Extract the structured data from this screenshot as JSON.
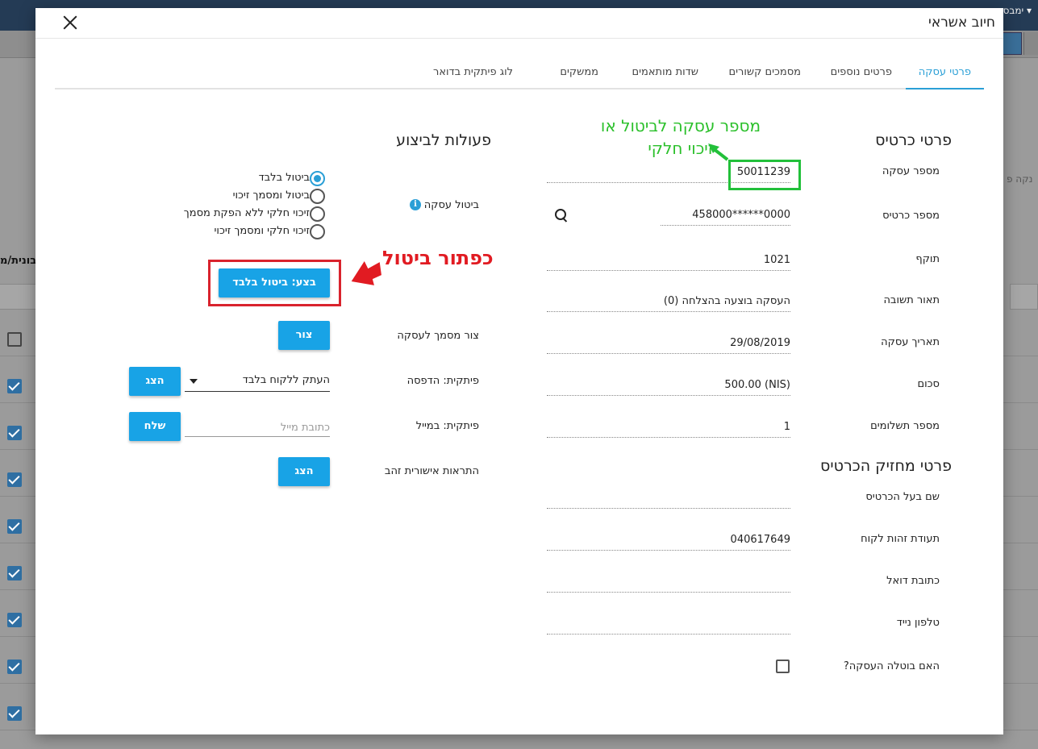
{
  "background": {
    "topbar_text": "ימבס ▾",
    "left_column_header": "בונית/מ",
    "right_filter_text": "נקה פ"
  },
  "modal": {
    "title": "חיוב אשראי",
    "tabs": [
      {
        "label": "פרטי עסקה",
        "active": true
      },
      {
        "label": "פרטים נוספים",
        "active": false
      },
      {
        "label": "מסמכים קשורים",
        "active": false
      },
      {
        "label": "שדות מותאמים",
        "active": false
      },
      {
        "label": "ממשקים",
        "active": false
      },
      {
        "label": "לוג פיתקית בדואר",
        "active": false
      }
    ],
    "card_section": {
      "title": "פרטי כרטיס",
      "fields": [
        {
          "label": "מספר עסקה",
          "value": "50011239"
        },
        {
          "label": "מספר כרטיס",
          "value": "458000******0000"
        },
        {
          "label": "תוקף",
          "value": "1021"
        },
        {
          "label": "תאור תשובה",
          "value": "העסקה בוצעה בהצלחה (0)"
        },
        {
          "label": "תאריך עסקה",
          "value": "29/08/2019"
        },
        {
          "label": "סכום",
          "value": "500.00 (NIS)"
        },
        {
          "label": "מספר תשלומים",
          "value": "1"
        }
      ]
    },
    "holder_section": {
      "title": "פרטי מחזיק הכרטיס",
      "fields": [
        {
          "label": "שם בעל הכרטיס",
          "value": ""
        },
        {
          "label": "תעודת זהות לקוח",
          "value": "040617649"
        },
        {
          "label": "כתובת דואל",
          "value": ""
        },
        {
          "label": "טלפון נייד",
          "value": ""
        }
      ],
      "cancelled_label": "האם בוטלה העסקה?"
    },
    "actions_section": {
      "title": "פעולות לביצוע",
      "cancel_label": "ביטול עסקה",
      "radio_options": [
        {
          "label": "ביטול בלבד",
          "checked": true
        },
        {
          "label": "ביטול ומסמך זיכוי",
          "checked": false
        },
        {
          "label": "זיכוי חלקי ללא הפקת מסמך",
          "checked": false
        },
        {
          "label": "זיכוי חלקי ומסמך זיכוי",
          "checked": false
        }
      ],
      "execute_button": "בצע: ביטול בלבד",
      "create_doc_label": "צור מסמך לעסקה",
      "create_button": "צור",
      "print_label": "פיתקית: הדפסה",
      "print_select_value": "העתק ללקוח בלבד",
      "show_button": "הצג",
      "email_label": "פיתקית: במייל",
      "email_placeholder": "כתובת מייל",
      "send_button": "שלח",
      "alerts_label": "התראות אישורית זהב",
      "alerts_button": "הצג"
    }
  },
  "annotations": {
    "green_text_line1": "מספר עסקה לביטול או",
    "green_text_line2": "זיכוי חלקי",
    "red_text": "כפתור ביטול"
  },
  "colors": {
    "accent": "#18a3e6",
    "annotation_green": "#22c03a",
    "annotation_red": "#e11b22"
  }
}
